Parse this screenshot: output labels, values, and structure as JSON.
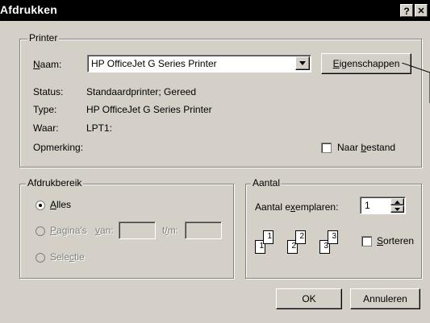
{
  "window": {
    "title": "Afdrukken",
    "help_button": "?",
    "close_button": "✕"
  },
  "printer": {
    "legend": "Printer",
    "name_label_u": "N",
    "name_label_rest": "aam:",
    "name_value": "HP OfficeJet G Series Printer",
    "properties_u": "E",
    "properties_rest": "igenschappen",
    "status_label": "Status:",
    "status_value": "Standaardprinter; Gereed",
    "type_label": "Type:",
    "type_value": "HP OfficeJet G Series Printer",
    "where_label": "Waar:",
    "where_value": "LPT1:",
    "comment_label": "Opmerking:",
    "to_file_pre": "Naar ",
    "to_file_u": "b",
    "to_file_rest": "estand"
  },
  "range": {
    "legend": "Afdrukbereik",
    "all_u": "A",
    "all_rest": "lles",
    "pages_u": "P",
    "pages_rest": "agina's",
    "from_u": "v",
    "from_rest": "an:",
    "to_pre": "t",
    "to_u": "/",
    "to_rest": "m:",
    "selection_pre": "Sele",
    "selection_u": "c",
    "selection_rest": "tie",
    "selected": "all"
  },
  "copies": {
    "legend": "Aantal",
    "count_pre": "Aantal e",
    "count_u": "x",
    "count_rest": "emplaren:",
    "count_value": "1",
    "collate_u": "S",
    "collate_rest": "orteren",
    "collate_checked": false,
    "stack_labels": [
      "1",
      "1",
      "2",
      "2",
      "3",
      "3"
    ]
  },
  "buttons": {
    "ok": "OK",
    "cancel": "Annuleren"
  }
}
